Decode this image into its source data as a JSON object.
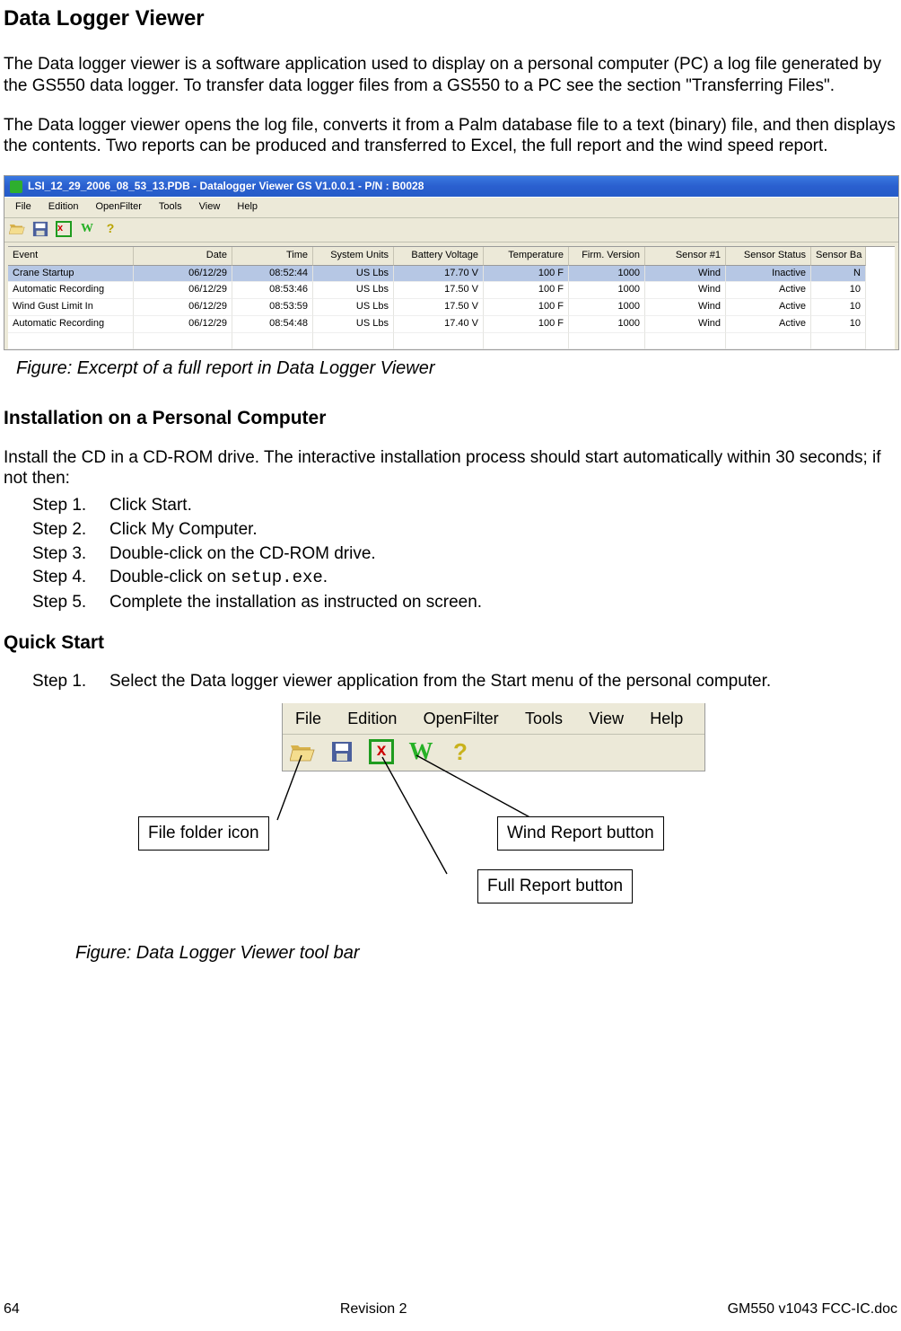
{
  "doc": {
    "title_h1": "Data Logger Viewer",
    "para1": "The Data logger viewer is a software application used to display on a personal computer (PC) a log file generated by the GS550 data logger. To transfer data logger files from a GS550 to a PC see the section \"Transferring Files\".",
    "para2": "The Data logger viewer opens the log file, converts it from a Palm database file to a text (binary) file, and then displays the contents. Two reports can be produced and transferred to Excel, the full report and the wind speed report.",
    "caption1": "Figure: Excerpt of a full report in Data Logger Viewer",
    "h2_install": "Installation on a Personal Computer",
    "install_intro": "Install the CD in a CD-ROM drive. The interactive installation process should start automatically within 30 seconds; if not then:",
    "install_steps": [
      {
        "label": "Step 1.",
        "text": "Click Start."
      },
      {
        "label": "Step 2.",
        "text": "Click My Computer."
      },
      {
        "label": "Step 3.",
        "text": "Double-click on the CD-ROM drive."
      },
      {
        "label": "Step 4.",
        "text_prefix": "Double-click on ",
        "code": "setup.exe",
        "text_suffix": "."
      },
      {
        "label": "Step 5.",
        "text": "Complete the installation as instructed on screen."
      }
    ],
    "h2_quick": "Quick Start",
    "quick_step1_label": "Step 1.",
    "quick_step1_text": "Select the Data logger viewer application from the Start menu of the personal computer.",
    "callout_file": "File folder icon",
    "callout_wind": "Wind Report button",
    "callout_full": "Full Report button",
    "caption2": "Figure: Data Logger Viewer tool bar",
    "footer_page": "64",
    "footer_center": "Revision 2",
    "footer_right": "GM550 v1043 FCC-IC.doc"
  },
  "app": {
    "title": "LSI_12_29_2006_08_53_13.PDB - Datalogger Viewer GS V1.0.0.1 - P/N : B0028",
    "menu": [
      "File",
      "Edition",
      "OpenFilter",
      "Tools",
      "View",
      "Help"
    ],
    "grid": {
      "headers": [
        "Event",
        "Date",
        "Time",
        "System Units",
        "Battery Voltage",
        "Temperature",
        "Firm. Version",
        "Sensor #1",
        "Sensor Status",
        "Sensor Ba"
      ],
      "rows": [
        {
          "cells": [
            "Crane Startup",
            "06/12/29",
            "08:52:44",
            "US Lbs",
            "17.70 V",
            "100 F",
            "1000",
            "Wind",
            "Inactive",
            "N"
          ],
          "sel": true
        },
        {
          "cells": [
            "Automatic Recording",
            "06/12/29",
            "08:53:46",
            "US Lbs",
            "17.50 V",
            "100 F",
            "1000",
            "Wind",
            "Active",
            "10"
          ],
          "sel": false
        },
        {
          "cells": [
            "Wind Gust Limit In",
            "06/12/29",
            "08:53:59",
            "US Lbs",
            "17.50 V",
            "100 F",
            "1000",
            "Wind",
            "Active",
            "10"
          ],
          "sel": false
        },
        {
          "cells": [
            "Automatic Recording",
            "06/12/29",
            "08:54:48",
            "US Lbs",
            "17.40 V",
            "100 F",
            "1000",
            "Wind",
            "Active",
            "10"
          ],
          "sel": false
        }
      ]
    }
  }
}
